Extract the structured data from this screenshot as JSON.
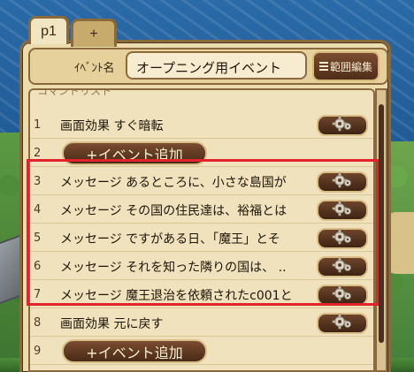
{
  "tabs": [
    {
      "label": "p1"
    },
    {
      "label": "+"
    }
  ],
  "event_name": {
    "label": "ｲﾍﾞﾝﾄ名",
    "value": "オープニング用イベント",
    "edit_range_label": "範囲編集"
  },
  "command_list": {
    "title": "コマンドリスト",
    "rows": [
      {
        "num": "1",
        "text": "画面効果  すぐ暗転",
        "type": "command"
      },
      {
        "num": "2",
        "text": "+イベント追加",
        "type": "add"
      },
      {
        "num": "3",
        "text": "メッセージ  あるところに、小さな島国が",
        "type": "command"
      },
      {
        "num": "4",
        "text": "メッセージ  その国の住民達は、裕福とは",
        "type": "command"
      },
      {
        "num": "5",
        "text": "メッセージ  ですがある日、「魔王」とそ",
        "type": "command"
      },
      {
        "num": "6",
        "text": "メッセージ  それを知った隣りの国は、 ..",
        "type": "command"
      },
      {
        "num": "7",
        "text": "メッセージ  魔王退治を依頼されたc001と",
        "type": "command"
      },
      {
        "num": "8",
        "text": "画面効果  元に戻す",
        "type": "command"
      },
      {
        "num": "9",
        "text": "+イベント追加",
        "type": "add"
      }
    ]
  },
  "icons": {
    "gear": "gear-icon",
    "list": "list-icon"
  },
  "colors": {
    "panel": "#ecdcae",
    "button": "#5a3620",
    "highlight": "#e2232b"
  }
}
